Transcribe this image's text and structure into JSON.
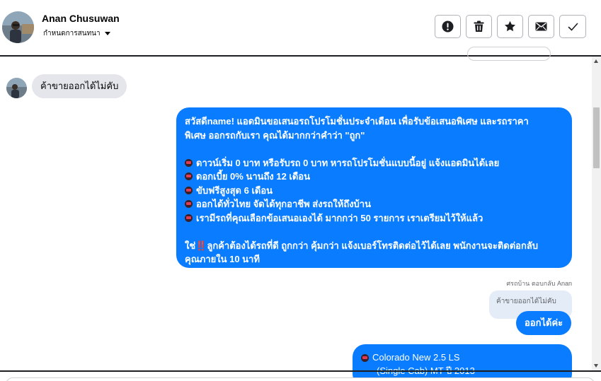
{
  "header": {
    "contact_name": "Anan Chusuwan",
    "subtitle": "กำหนดการสนทนา",
    "actions": [
      {
        "name": "report-button",
        "icon": "exclamation-circle-icon"
      },
      {
        "name": "delete-button",
        "icon": "trash-icon"
      },
      {
        "name": "star-button",
        "icon": "star-icon"
      },
      {
        "name": "mark-unread-button",
        "icon": "envelope-icon"
      },
      {
        "name": "done-button",
        "icon": "check-icon"
      }
    ]
  },
  "messages": {
    "incoming_1": "ค้าขายออกได้ไม่คับ",
    "outgoing_promo": {
      "line1": "สวัสดีname! แอดมินขอเสนอรถโปรโมชั่นประจำเดือน เพื่อรับข้อเสนอพิเศษ และรถราคา",
      "line2": "พิเศษ ออกรถกับเรา คุณได้มากกว่าคำว่า \"ถูก\"",
      "bullets": [
        "ดาวน์เริ่ม 0 บาท หรือรับรถ 0 บาท หารถโปรโมชั่นแบบนี้อยู่ แจ้งแอดมินได้เลย",
        "ดอกเบี้ย 0% นานถึง 12 เดือน",
        "ขับฟรีสูงสุด 6 เดือน",
        "ออกได้ทั่วไทย จัดได้ทุกอาชีพ ส่งรถให้ถึงบ้าน",
        "เรามีรถที่คุณเลือกข้อเสนอเองได้ มากกว่า 50 รายการ เราเตรียมไว้ให้แล้ว"
      ],
      "closing_prefix": "ใช่",
      "closing_mark": "‼️",
      "closing_rest": "ลูกค้าต้องได้รถที่ดี ถูกกว่า คุ้มกว่า แจ้งเบอร์โทรติดต่อไว้ได้เลย พนักงานจะติดต่อกลับ",
      "closing_line2": "คุณภายใน 10 นาที"
    },
    "reply_label": "ศรถบ้าน ตอบกลับ Anan",
    "quoted_text": "ค้าขายออกได้ไม่คับ",
    "reply_text": "ออกได้ค่ะ",
    "card": {
      "line1": "Colorado New 2.5 LS",
      "line2": "(Single Cab) MT ปี 2013"
    }
  },
  "colors": {
    "accent": "#0a7cff",
    "incoming_bg": "#e4e6eb",
    "quote_bg": "#e4ecf7"
  }
}
